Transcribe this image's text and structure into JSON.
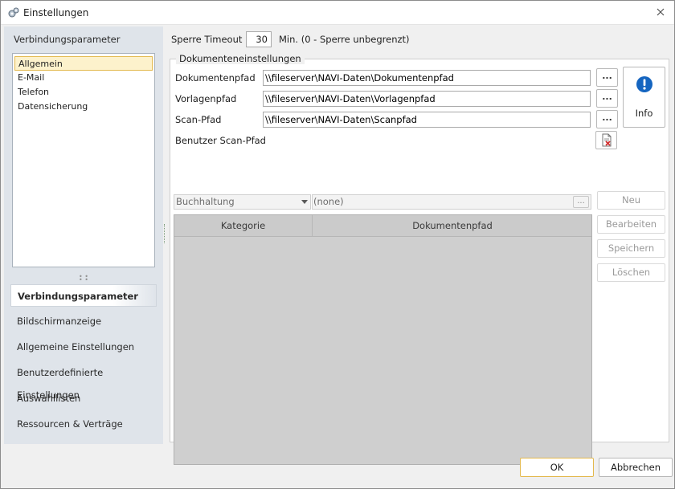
{
  "window": {
    "title": "Einstellungen",
    "title_icon": "settings-gears-icon",
    "close_icon": "close-icon"
  },
  "left": {
    "header": "Verbindungsparameter",
    "list": [
      "Allgemein",
      "E-Mail",
      "Telefon",
      "Datensicherung"
    ],
    "selected": "Allgemein",
    "nav": [
      "Verbindungsparameter",
      "Bildschirmanzeige",
      "Allgemeine Einstellungen",
      "Benutzerdefinierte Einstellungen",
      "Auswahllisten",
      "Ressourcen & Verträge"
    ],
    "nav_active": "Verbindungsparameter"
  },
  "main": {
    "timeout_label": "Sperre Timeout",
    "timeout_value": "30",
    "timeout_hint": "Min. (0 - Sperre unbegrenzt)",
    "group_title": "Dokumenteneinstellungen",
    "fields": [
      {
        "label": "Dokumentenpfad",
        "value": "\\\\fileserver\\NAVI-Daten\\Dokumentenpfad",
        "button": "..."
      },
      {
        "label": "Vorlagenpfad",
        "value": "\\\\fileserver\\NAVI-Daten\\Vorlagenpfad",
        "button": "..."
      },
      {
        "label": "Scan-Pfad",
        "value": "\\\\fileserver\\NAVI-Daten\\Scanpfad",
        "button": "..."
      }
    ],
    "user_scan_label": "Benutzer Scan-Pfad",
    "info_button": {
      "label": "Info",
      "icon": "exclamation-info-icon"
    },
    "category_combo": "Buchhaltung",
    "path_field": "(none)",
    "path_field_button": "...",
    "grid_columns": [
      "Kategorie",
      "Dokumentenpfad"
    ],
    "buttons": [
      "Neu",
      "Bearbeiten",
      "Speichern",
      "Löschen"
    ]
  },
  "footer": {
    "ok": "OK",
    "cancel": "Abbrechen"
  },
  "colors": {
    "accent_border": "#e3b94e",
    "selection_bg": "#fdf2cc",
    "left_panel_bg": "#dfe4ea",
    "info_icon_blue": "#1565c0"
  }
}
